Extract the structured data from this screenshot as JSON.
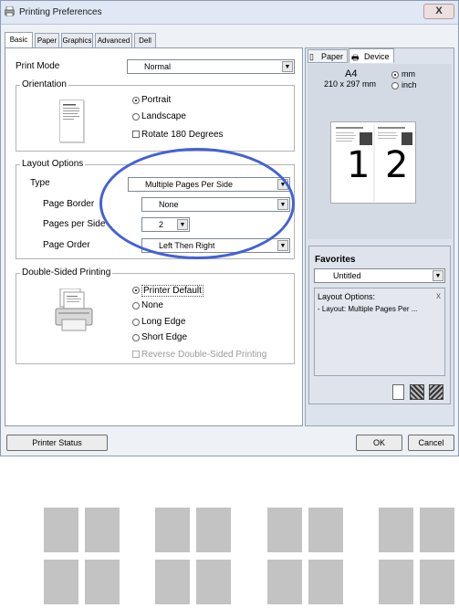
{
  "window": {
    "title": "Printing Preferences",
    "close_label": "X"
  },
  "tabs": [
    "Basic",
    "Paper",
    "Graphics",
    "Advanced",
    "Dell"
  ],
  "basic": {
    "print_mode_label": "Print Mode",
    "print_mode_value": "Normal",
    "orientation": {
      "title": "Orientation",
      "options": [
        "Portrait",
        "Landscape"
      ],
      "selected": "Portrait",
      "rotate_label": "Rotate 180 Degrees"
    },
    "layout": {
      "title": "Layout Options",
      "type_label": "Type",
      "type_value": "Multiple Pages Per Side",
      "border_label": "Page Border",
      "border_value": "None",
      "pages_label": "Pages per Side",
      "pages_value": "2",
      "order_label": "Page Order",
      "order_value": "Left Then Right"
    },
    "duplex": {
      "title": "Double-Sided Printing",
      "options": [
        "Printer Default",
        "None",
        "Long Edge",
        "Short Edge"
      ],
      "selected": "Printer Default",
      "reverse_label": "Reverse Double-Sided Printing"
    }
  },
  "preview": {
    "tab_paper": "Paper",
    "tab_device": "Device",
    "paper_name": "A4",
    "paper_size": "210 x 297 mm",
    "unit_mm": "mm",
    "unit_inch": "inch",
    "selected_unit": "mm",
    "page_num_1": "1",
    "page_num_2": "2"
  },
  "favorites": {
    "title": "Favorites",
    "value": "Untitled",
    "info_title": "Layout Options:",
    "info_line": "- Layout: Multiple Pages Per ..."
  },
  "buttons": {
    "printer_status": "Printer Status",
    "ok": "OK",
    "cancel": "Cancel"
  },
  "colors": {
    "highlight_ellipse": "#4361d6",
    "thumb_gray": "#c3c3c3"
  }
}
